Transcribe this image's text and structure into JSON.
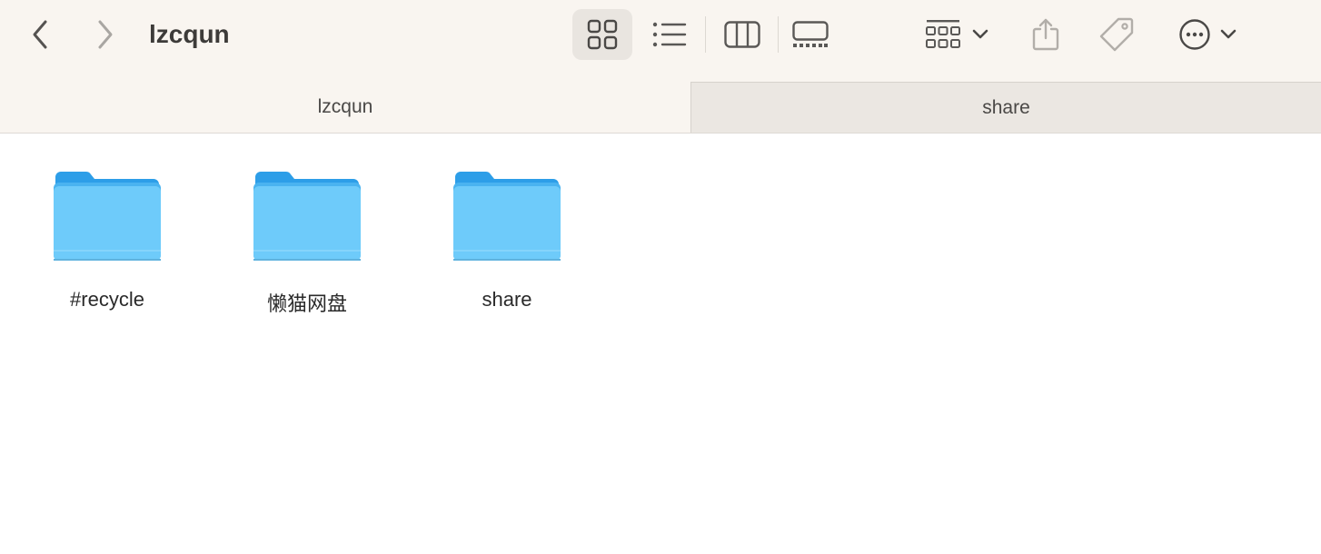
{
  "window": {
    "title": "lzcqun"
  },
  "toolbar": {
    "back": "chevron-left-icon",
    "forward": "chevron-right-icon",
    "views": [
      "icon-view",
      "list-view",
      "column-view",
      "gallery-view"
    ],
    "selected_view": "icon-view",
    "actions": [
      "group-icon",
      "share-icon",
      "tag-icon",
      "more-icon"
    ]
  },
  "tabs": [
    {
      "label": "lzcqun",
      "active": true
    },
    {
      "label": "share",
      "active": false
    }
  ],
  "items": [
    {
      "name": "#recycle",
      "kind": "folder"
    },
    {
      "name": "懒猫网盘",
      "kind": "folder"
    },
    {
      "name": "share",
      "kind": "folder"
    }
  ],
  "colors": {
    "folder_top": "#2d9ee8",
    "folder_body": "#6ecbfa",
    "toolbar_bg": "#f9f5f0",
    "inactive_tab_bg": "#ebe7e2"
  }
}
